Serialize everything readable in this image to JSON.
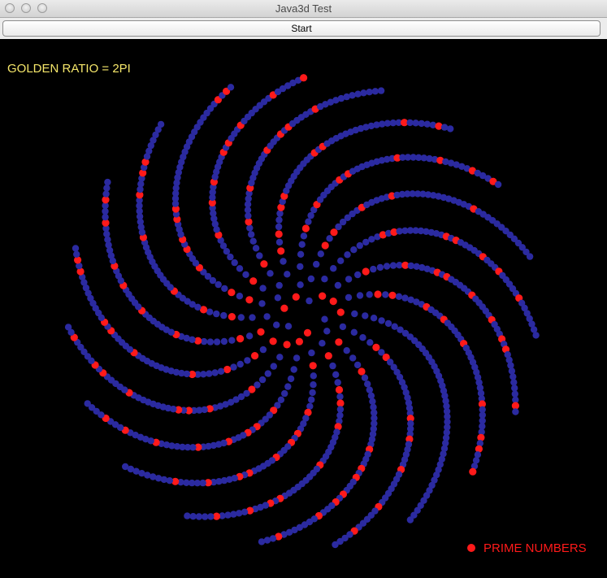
{
  "window": {
    "title": "Java3d Test"
  },
  "toolbar": {
    "start_label": "Start"
  },
  "canvas": {
    "heading": "GOLDEN RATIO = 2PI",
    "legend": {
      "label": "PRIME NUMBERS",
      "color": "#ff1a1a"
    },
    "colors": {
      "background": "#000000",
      "heading": "#f5e66a",
      "point": "#2b2aa0",
      "prime_point": "#ff1a1a"
    }
  },
  "chart_data": {
    "type": "scatter",
    "title": "GOLDEN RATIO = 2PI",
    "series": [
      {
        "name": "PRIME NUMBERS"
      }
    ]
  }
}
